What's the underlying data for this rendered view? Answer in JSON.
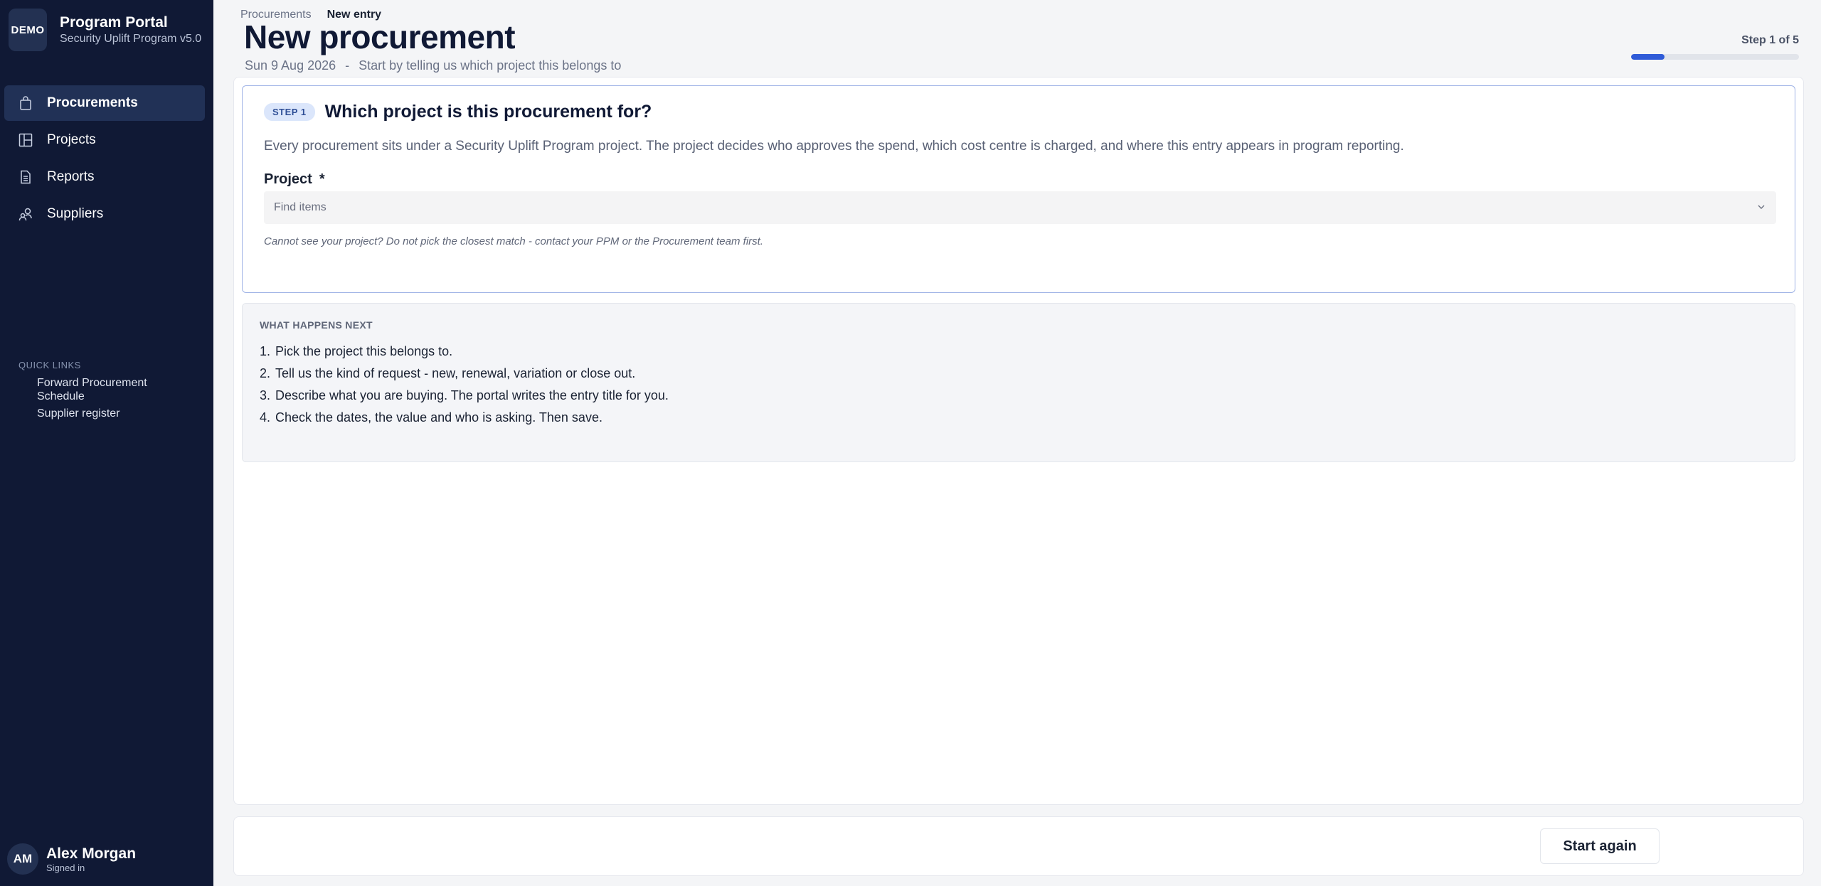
{
  "sidebar": {
    "logo": "DEMO",
    "app_title": "Program Portal",
    "app_subtitle": "Security Uplift Program v5.0",
    "nav": [
      {
        "label": "Procurements",
        "icon": "bag-icon",
        "active": true
      },
      {
        "label": "Projects",
        "icon": "grid-icon",
        "active": false
      },
      {
        "label": "Reports",
        "icon": "document-icon",
        "active": false
      },
      {
        "label": "Suppliers",
        "icon": "people-icon",
        "active": false
      }
    ],
    "quick_links_title": "QUICK LINKS",
    "quick_links": [
      "Forward Procurement Schedule",
      "Supplier register"
    ],
    "user": {
      "initials": "AM",
      "name": "Alex Morgan",
      "status": "Signed in"
    }
  },
  "header": {
    "breadcrumb": {
      "parent": "Procurements",
      "current": "New entry"
    },
    "title": "New procurement",
    "date": "Sun 9 Aug 2026",
    "separator": "-",
    "subtitle": "Start by telling us which project this belongs to",
    "step_counter": "Step 1 of 5",
    "progress_fraction": 0.2
  },
  "step_card": {
    "badge": "STEP 1",
    "question": "Which project is this procurement for?",
    "description": "Every procurement sits under a Security Uplift Program project. The project decides who approves the spend, which cost centre is charged, and where this entry appears in program reporting.",
    "field_label": "Project",
    "required_marker": "*",
    "select_placeholder": "Find items",
    "hint": "Cannot see your project? Do not pick the closest match - contact your PPM or the Procurement team first."
  },
  "next_steps": {
    "title": "WHAT HAPPENS NEXT",
    "items": [
      {
        "num": "1.",
        "text": "Pick the project this belongs to."
      },
      {
        "num": "2.",
        "text": "Tell us the kind of request - new, renewal, variation or close out."
      },
      {
        "num": "3.",
        "text": "Describe what you are buying. The portal writes the entry title for you."
      },
      {
        "num": "4.",
        "text": "Check the dates, the value and who is asking. Then save."
      }
    ]
  },
  "footer": {
    "restart_label": "Start again"
  },
  "colors": {
    "sidebar_bg": "#101935",
    "accent": "#2f5bd8",
    "active_nav": "#213156"
  }
}
